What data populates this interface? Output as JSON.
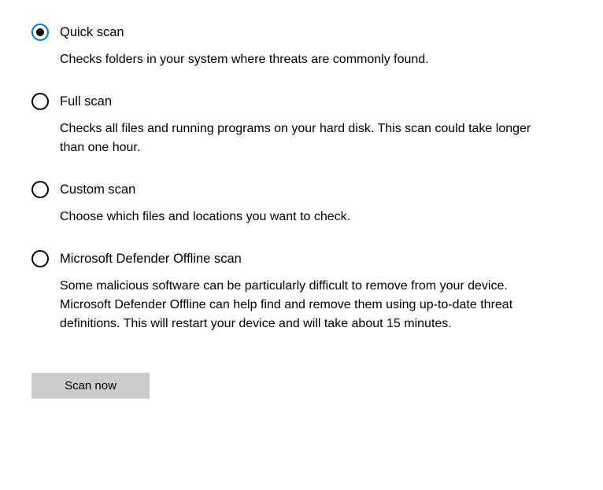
{
  "options": [
    {
      "title": "Quick scan",
      "description": "Checks folders in your system where threats are commonly found.",
      "selected": true
    },
    {
      "title": "Full scan",
      "description": "Checks all files and running programs on your hard disk. This scan could take longer than one hour.",
      "selected": false
    },
    {
      "title": "Custom scan",
      "description": "Choose which files and locations you want to check.",
      "selected": false
    },
    {
      "title": "Microsoft Defender Offline scan",
      "description": "Some malicious software can be particularly difficult to remove from your device. Microsoft Defender Offline can help find and remove them using up-to-date threat definitions. This will restart your device and will take about 15 minutes.",
      "selected": false
    }
  ],
  "button": {
    "label": "Scan now"
  }
}
